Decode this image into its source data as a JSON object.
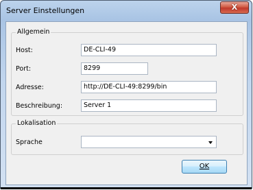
{
  "window": {
    "title": "Server Einstellungen",
    "close_glyph": "X"
  },
  "general": {
    "legend": "Allgemein",
    "host_label": "Host:",
    "host_value": "DE-CLI-49",
    "port_label": "Port:",
    "port_value": "8299",
    "address_label": "Adresse:",
    "address_value": "http://DE-CLI-49:8299/bin",
    "description_label": "Beschreibung:",
    "description_value": "Server 1"
  },
  "localization": {
    "legend": "Lokalisation",
    "language_label": "Sprache",
    "language_value": ""
  },
  "buttons": {
    "ok_label": "OK"
  }
}
